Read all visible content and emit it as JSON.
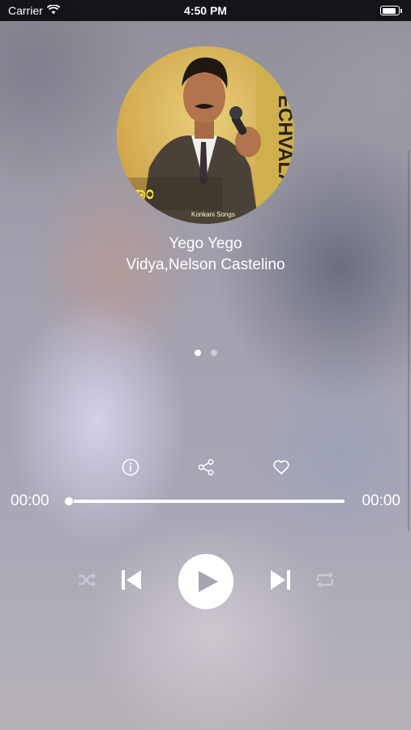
{
  "status_bar": {
    "carrier": "Carrier",
    "time": "4:50 PM",
    "battery_level": 1.0
  },
  "artwork": {
    "kannada_text": "ಲಾಂ",
    "english_text": "Konkani Songs",
    "cover_text": "ECHVALA"
  },
  "song": {
    "title": "Yego Yego",
    "artist": "Vidya,Nelson Castelino"
  },
  "pager": {
    "page_count": 2,
    "current_page": 1
  },
  "actions": {
    "info_icon": "info-icon",
    "share_icon": "share-icon",
    "favorite_icon": "heart-icon"
  },
  "playback": {
    "elapsed": "00:00",
    "duration": "00:00",
    "progress_fraction": 0.0
  },
  "controls": {
    "shuffle_icon": "shuffle-icon",
    "previous_icon": "previous-icon",
    "play_icon": "play-icon",
    "next_icon": "next-icon",
    "repeat_icon": "repeat-icon"
  },
  "colors": {
    "control_white": "#ffffff",
    "control_disabled": "#c8c8d6",
    "play_glyph": "#a6a5b0"
  }
}
